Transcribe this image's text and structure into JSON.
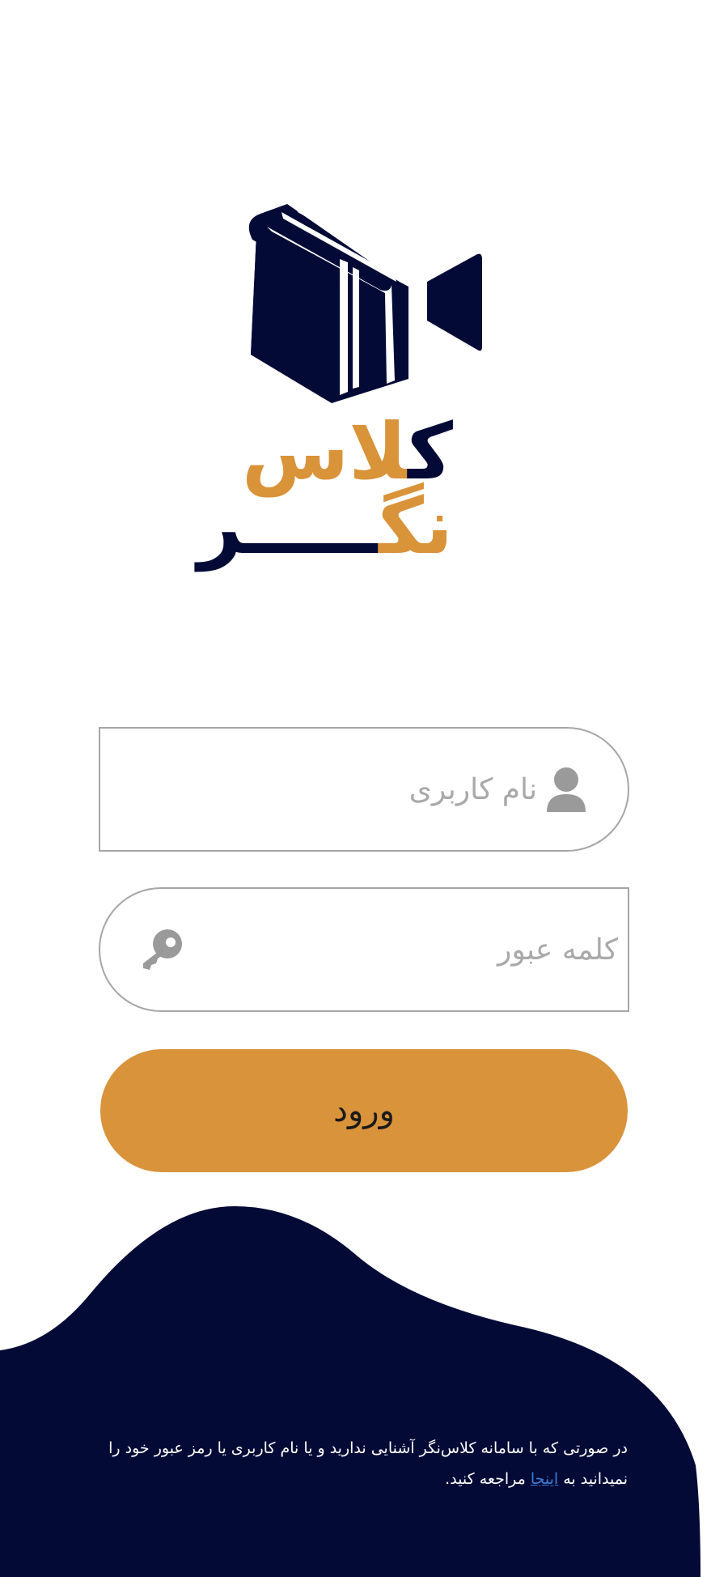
{
  "brand": {
    "line1_k": "ک",
    "line1_las": "لاس",
    "line2_ng": "نگ",
    "line2_r": "ـــــر"
  },
  "form": {
    "username": {
      "placeholder": "نام کاربری",
      "value": "",
      "icon": "user-icon"
    },
    "password": {
      "placeholder": "کلمه عبور",
      "value": "",
      "icon": "key-icon"
    },
    "submit_label": "ورود"
  },
  "help": {
    "line1": "در صورتی که با سامانه کلاس‌نگر آشنایی ندارید و یا نام کاربری یا رمز عبور خود را",
    "line2_pre": "نمیدانید به ",
    "link_text": "اینجا",
    "line2_post": " مراجعه کنید."
  },
  "colors": {
    "navy": "#030a36",
    "orange": "#d9933b",
    "link": "#3e7bd0",
    "border": "#a6a6a6",
    "placeholder": "#a9a9a9"
  }
}
